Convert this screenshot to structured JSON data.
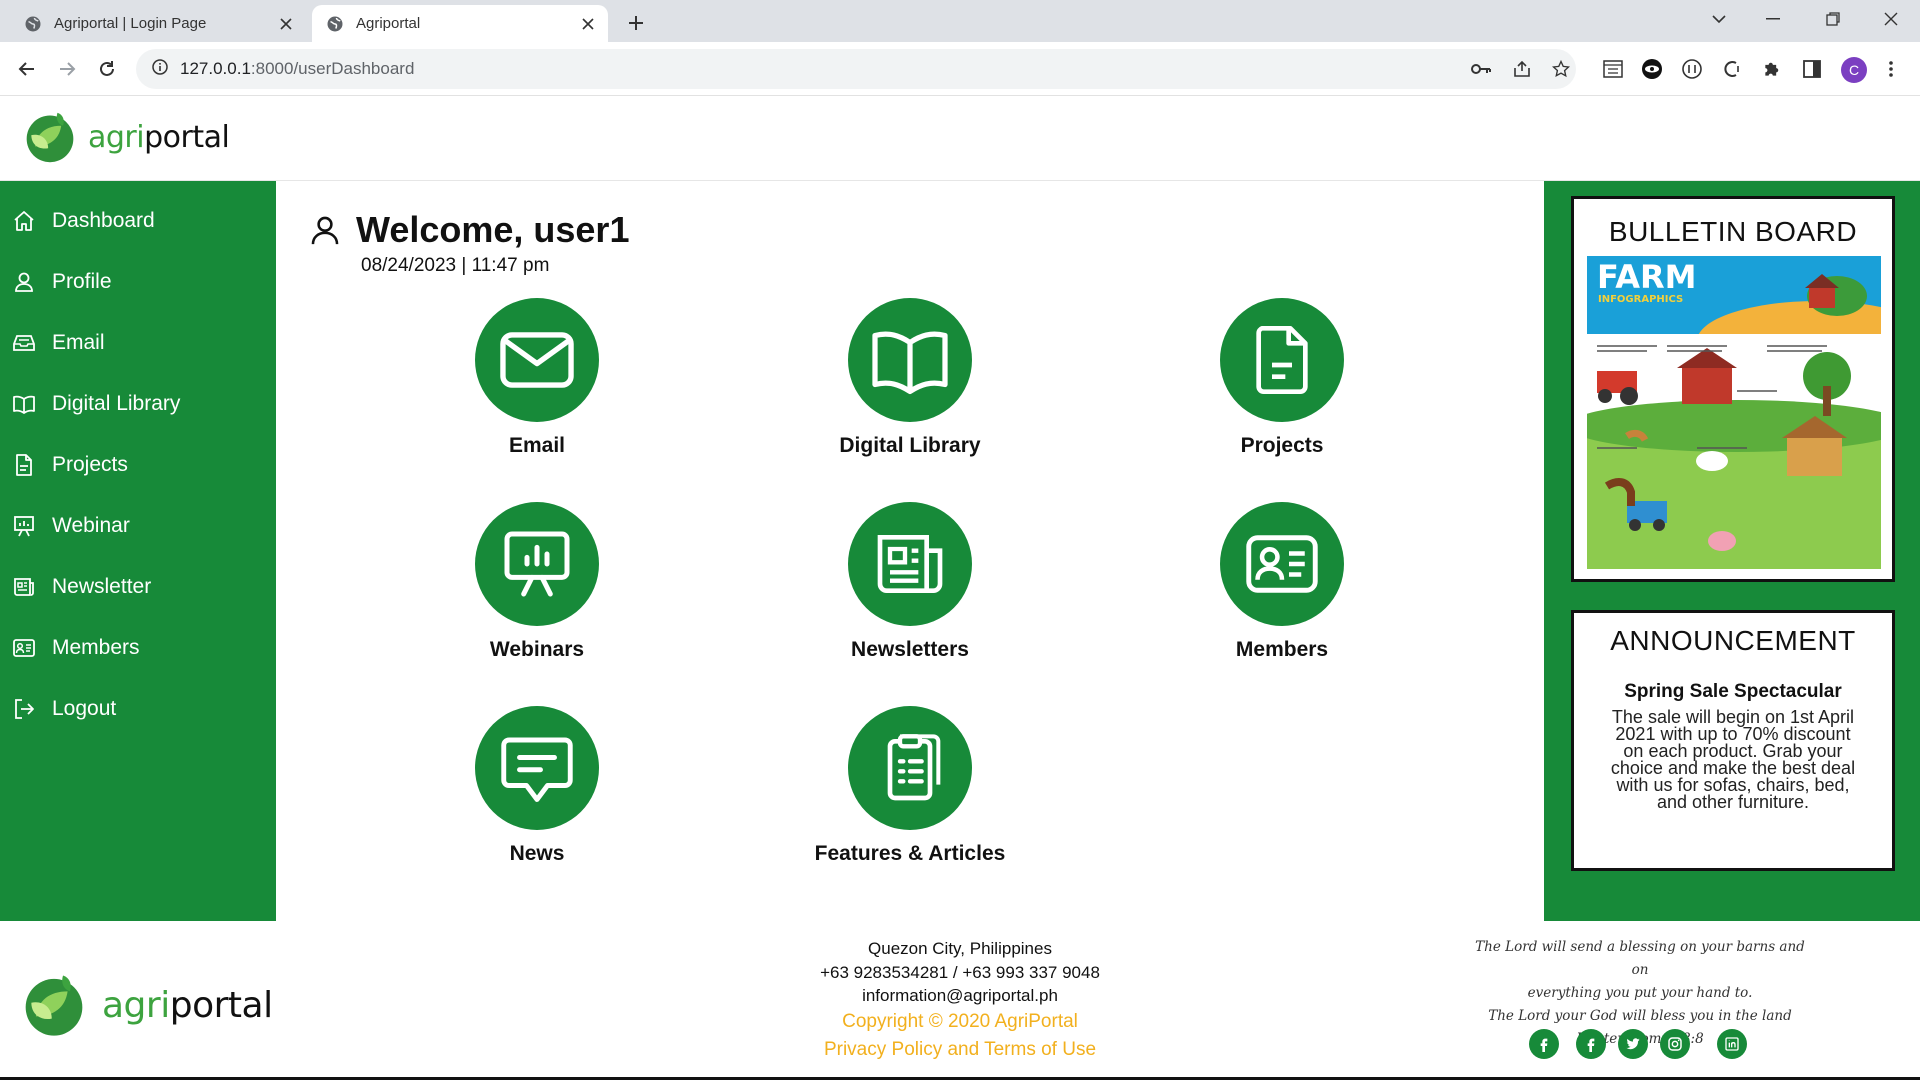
{
  "browser": {
    "tabs": [
      {
        "title": "Agriportal | Login Page",
        "active": false
      },
      {
        "title": "Agriportal",
        "active": true
      }
    ],
    "url_host": "127.0.0.1",
    "url_rest": ":8000/userDashboard",
    "profile_initial": "C"
  },
  "brand": {
    "word_part1": "agri",
    "word_part2": "portal",
    "color_primary": "#178a39",
    "color_accent": "#3da33f",
    "color_gold": "#f2b01e"
  },
  "sidebar": {
    "items": [
      {
        "label": "Dashboard",
        "icon": "home-icon"
      },
      {
        "label": "Profile",
        "icon": "user-icon"
      },
      {
        "label": "Email",
        "icon": "inbox-icon"
      },
      {
        "label": "Digital Library",
        "icon": "book-icon"
      },
      {
        "label": "Projects",
        "icon": "file-icon"
      },
      {
        "label": "Webinar",
        "icon": "presentation-icon"
      },
      {
        "label": "Newsletter",
        "icon": "newspaper-icon"
      },
      {
        "label": "Members",
        "icon": "id-card-icon"
      },
      {
        "label": "Logout",
        "icon": "logout-icon"
      }
    ]
  },
  "main": {
    "welcome": "Welcome, user1",
    "datetime": "08/24/2023 | 11:47 pm",
    "tiles": [
      {
        "label": "Email",
        "icon": "envelope-icon"
      },
      {
        "label": "Digital Library",
        "icon": "book-open-icon"
      },
      {
        "label": "Projects",
        "icon": "document-icon"
      },
      {
        "label": "Webinars",
        "icon": "presentation-icon"
      },
      {
        "label": "Newsletters",
        "icon": "newspaper-icon"
      },
      {
        "label": "Members",
        "icon": "id-card-icon"
      },
      {
        "label": "News",
        "icon": "chat-bubble-icon"
      },
      {
        "label": "Features & Articles",
        "icon": "clipboard-icon"
      }
    ]
  },
  "bulletin": {
    "title": "BULLETIN BOARD",
    "image": {
      "headline": "FARM",
      "subheadline": "INFOGRAPHICS"
    }
  },
  "announcement": {
    "title": "ANNOUNCEMENT",
    "heading": "Spring Sale Spectacular",
    "body": "The sale will begin on 1st April 2021 with up to 70% discount on each product. Grab your choice and make the best deal with us for sofas, chairs, bed, and other furniture."
  },
  "footer": {
    "address": "Quezon City, Philippines",
    "phones": "+63 9283534281 / +63 993 337 9048",
    "email": "information@agriportal.ph",
    "copyright": "Copyright © 2020 AgriPortal",
    "policy": "Privacy Policy and Terms of Use",
    "verse_lines": [
      "The Lord will send a blessing on your barns and on",
      "everything you put your hand to.",
      "The Lord your God will bless you in the land",
      "Deuteronomy 28:8"
    ],
    "social": [
      "facebook-icon",
      "facebook-icon",
      "twitter-icon",
      "instagram-icon",
      "linkedin-icon"
    ]
  }
}
